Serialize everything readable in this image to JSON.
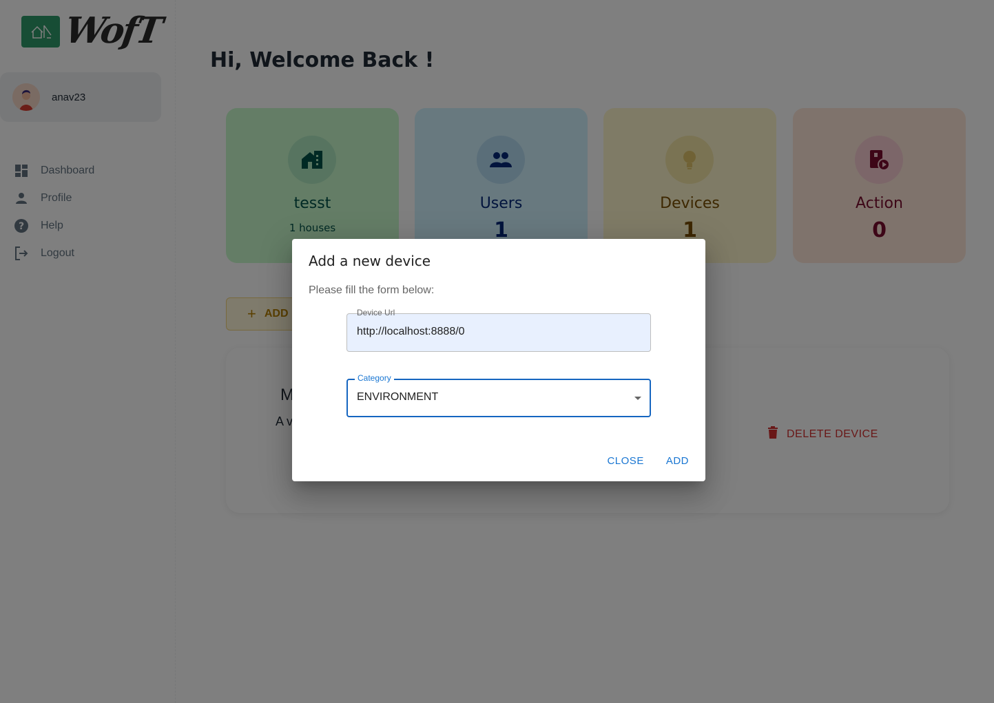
{
  "app": {
    "logo_text": "WofT"
  },
  "account": {
    "username": "anav23"
  },
  "nav": {
    "items": [
      {
        "label": "Dashboard",
        "icon": "dashboard-icon"
      },
      {
        "label": "Profile",
        "icon": "person-icon"
      },
      {
        "label": "Help",
        "icon": "help-icon"
      },
      {
        "label": "Logout",
        "icon": "logout-icon"
      }
    ]
  },
  "main": {
    "title": "Hi, Welcome Back !",
    "cards": [
      {
        "title": "tesst",
        "subtitle": "1 houses",
        "icon": "house-icon",
        "color": "#005249",
        "bg": "#c8facd"
      },
      {
        "title": "Users",
        "value": "1",
        "icon": "users-icon",
        "color": "#04297a",
        "bg": "#d0f2ff"
      },
      {
        "title": "Devices",
        "value": "1",
        "icon": "lightbulb-icon",
        "color": "#7a4f01",
        "bg": "#fff7cd"
      },
      {
        "title": "Action",
        "value": "0",
        "icon": "action-icon",
        "color": "#7a0c2e",
        "bg": "#ffe7d9"
      }
    ],
    "add_button_label": "ADD",
    "device": {
      "name": "M",
      "description": "A v",
      "delete_label": "DELETE DEVICE"
    }
  },
  "dialog": {
    "title": "Add a new device",
    "text": "Please fill the form below:",
    "url_label": "Device Url",
    "url_value": "http://localhost:8888/0",
    "category_label": "Category",
    "category_value": "ENVIRONMENT",
    "close_label": "CLOSE",
    "add_label": "ADD"
  }
}
